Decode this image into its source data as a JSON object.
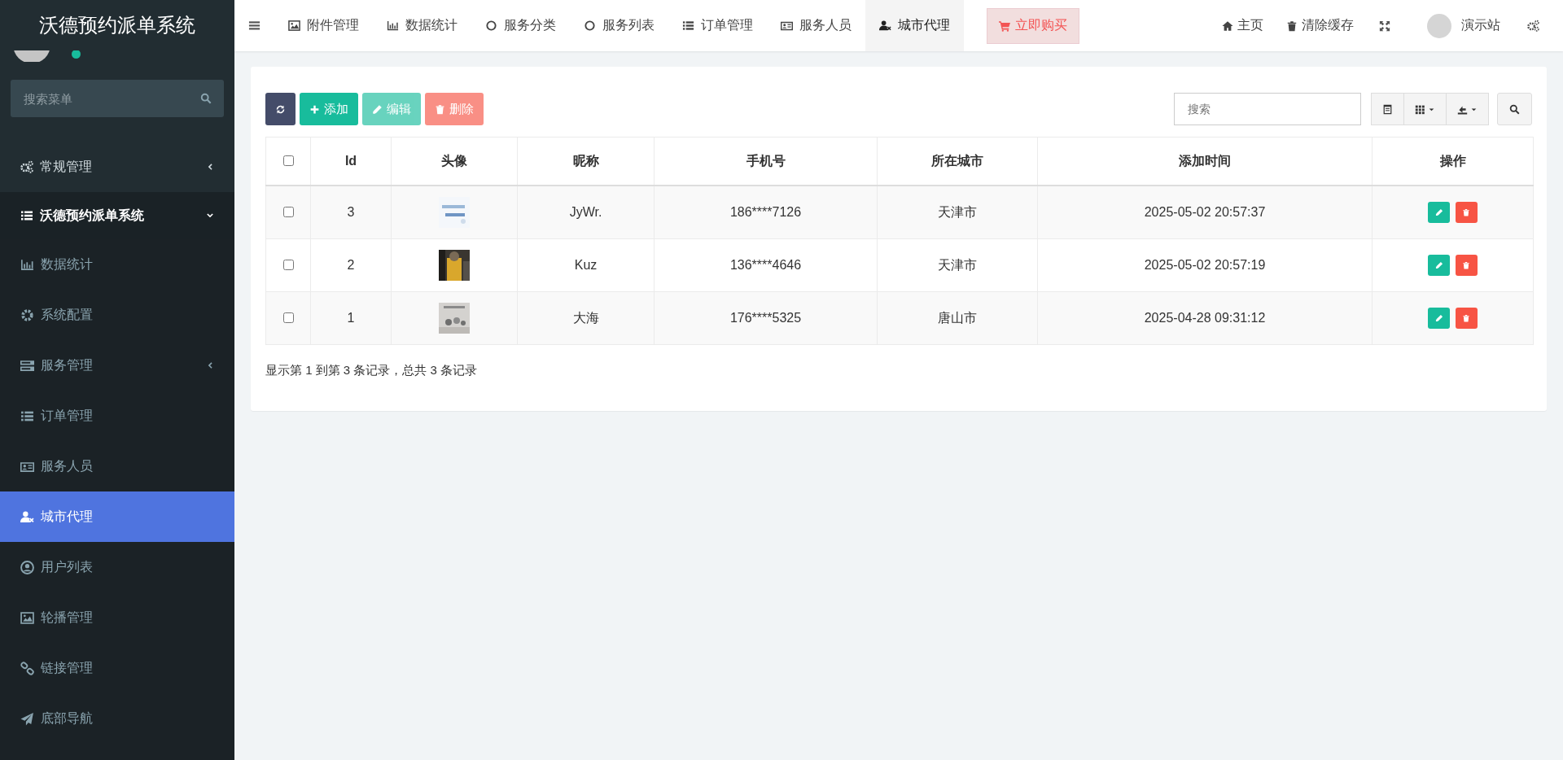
{
  "sidebar": {
    "title": "沃德预约派单系统",
    "user": {
      "online": true
    },
    "search": {
      "placeholder": "搜索菜单"
    },
    "items": [
      {
        "label": "常规管理",
        "expanded": false
      },
      {
        "label": "沃德预约派单系统",
        "expanded": true,
        "children": [
          {
            "label": "数据统计",
            "selected": false
          },
          {
            "label": "系统配置",
            "selected": false
          },
          {
            "label": "服务管理",
            "selected": false,
            "expanded": false
          },
          {
            "label": "订单管理",
            "selected": false
          },
          {
            "label": "服务人员",
            "selected": false
          },
          {
            "label": "城市代理",
            "selected": true
          },
          {
            "label": "用户列表",
            "selected": false
          },
          {
            "label": "轮播管理",
            "selected": false
          },
          {
            "label": "链接管理",
            "selected": false
          },
          {
            "label": "底部导航",
            "selected": false
          }
        ]
      }
    ]
  },
  "tabs": [
    {
      "label": "附件管理",
      "selected": false
    },
    {
      "label": "数据统计",
      "selected": false
    },
    {
      "label": "服务分类",
      "selected": false
    },
    {
      "label": "服务列表",
      "selected": false
    },
    {
      "label": "订单管理",
      "selected": false
    },
    {
      "label": "服务人员",
      "selected": false
    },
    {
      "label": "城市代理",
      "selected": true
    }
  ],
  "buy_button": "立即购买",
  "header_links": [
    {
      "label": "主页"
    },
    {
      "label": "清除缓存"
    }
  ],
  "account": {
    "name": "演示站"
  },
  "toolbar": {
    "buttons": [
      {
        "kind": "refresh",
        "disabled": false
      },
      {
        "label": "添加",
        "kind": "add",
        "disabled": false
      },
      {
        "label": "编辑",
        "kind": "edit",
        "disabled": true
      },
      {
        "label": "删除",
        "kind": "delete",
        "disabled": true
      }
    ],
    "search": {
      "placeholder": "搜索"
    }
  },
  "table": {
    "select_all": {
      "checked": false
    },
    "columns": [
      "Id",
      "头像",
      "昵称",
      "手机号",
      "所在城市",
      "添加时间",
      "操作"
    ],
    "rows": [
      {
        "checked": false,
        "id": "3",
        "nickname": "JyWr.",
        "phone": "186****7126",
        "city": "天津市",
        "added": "2025-05-02 20:57:37"
      },
      {
        "checked": false,
        "id": "2",
        "nickname": "Kuz",
        "phone": "136****4646",
        "city": "天津市",
        "added": "2025-05-02 20:57:19"
      },
      {
        "checked": false,
        "id": "1",
        "nickname": "大海",
        "phone": "176****5325",
        "city": "唐山市",
        "added": "2025-04-28 09:31:12"
      }
    ]
  },
  "pagination_info": "显示第 1 到第 3 条记录，总共 3 条记录"
}
